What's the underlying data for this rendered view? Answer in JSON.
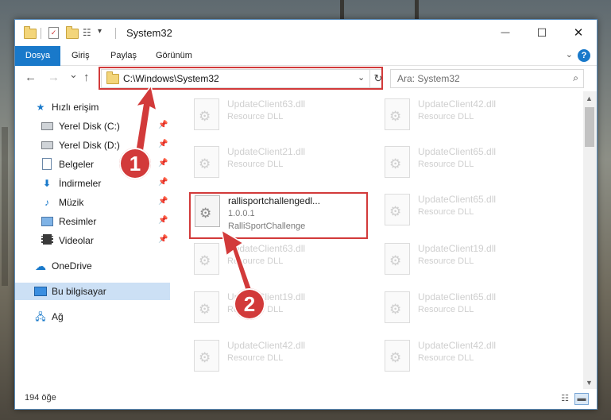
{
  "window": {
    "title": "System32",
    "minimize": "—",
    "maximize": "☐",
    "close": "✕"
  },
  "ribbon": {
    "tabs": [
      "Dosya",
      "Giriş",
      "Paylaş",
      "Görünüm"
    ],
    "help": "?"
  },
  "nav": {
    "back": "←",
    "forward": "→",
    "recent": "⌄",
    "up": "↑",
    "address": "C:\\Windows\\System32",
    "search_placeholder": "Ara: System32"
  },
  "sidebar": {
    "items": [
      {
        "label": "Hızlı erişim",
        "icon": "star-icon",
        "pinned": false
      },
      {
        "label": "Yerel Disk (C:)",
        "icon": "drive-icon",
        "pinned": true
      },
      {
        "label": "Yerel Disk (D:)",
        "icon": "drive-icon",
        "pinned": true
      },
      {
        "label": "Belgeler",
        "icon": "documents-icon",
        "pinned": true
      },
      {
        "label": "İndirmeler",
        "icon": "download-icon",
        "pinned": true
      },
      {
        "label": "Müzik",
        "icon": "music-icon",
        "pinned": true
      },
      {
        "label": "Resimler",
        "icon": "pictures-icon",
        "pinned": true
      },
      {
        "label": "Videolar",
        "icon": "videos-icon",
        "pinned": true
      },
      {
        "label": "OneDrive",
        "icon": "cloud-icon",
        "pinned": false
      },
      {
        "label": "Bu bilgisayar",
        "icon": "computer-icon",
        "pinned": false,
        "selected": true
      },
      {
        "label": "Ağ",
        "icon": "network-icon",
        "pinned": false
      }
    ]
  },
  "files": [
    {
      "name": "UpdateClient63.dll",
      "desc": "Resource DLL"
    },
    {
      "name": "UpdateClient42.dll",
      "desc": "Resource DLL"
    },
    {
      "name": "UpdateClient21.dll",
      "desc": "Resource DLL"
    },
    {
      "name": "UpdateClient65.dll",
      "desc": "Resource DLL"
    },
    {
      "name": "rallisportchallengedl...",
      "desc": "1.0.0.1",
      "extra": "RalliSportChallenge",
      "highlighted": true
    },
    {
      "name": "UpdateClient65.dll",
      "desc": "Resource DLL"
    },
    {
      "name": "UpdateClient63.dll",
      "desc": "Resource DLL"
    },
    {
      "name": "UpdateClient19.dll",
      "desc": "Resource DLL"
    },
    {
      "name": "UpdateClient19.dll",
      "desc": "Resource DLL"
    },
    {
      "name": "UpdateClient65.dll",
      "desc": "Resource DLL"
    },
    {
      "name": "UpdateClient42.dll",
      "desc": "Resource DLL"
    },
    {
      "name": "UpdateClient42.dll",
      "desc": "Resource DLL"
    }
  ],
  "status": {
    "count": "194 öğe"
  },
  "annotations": {
    "step1": "1",
    "step2": "2",
    "color": "#d23a3a"
  }
}
